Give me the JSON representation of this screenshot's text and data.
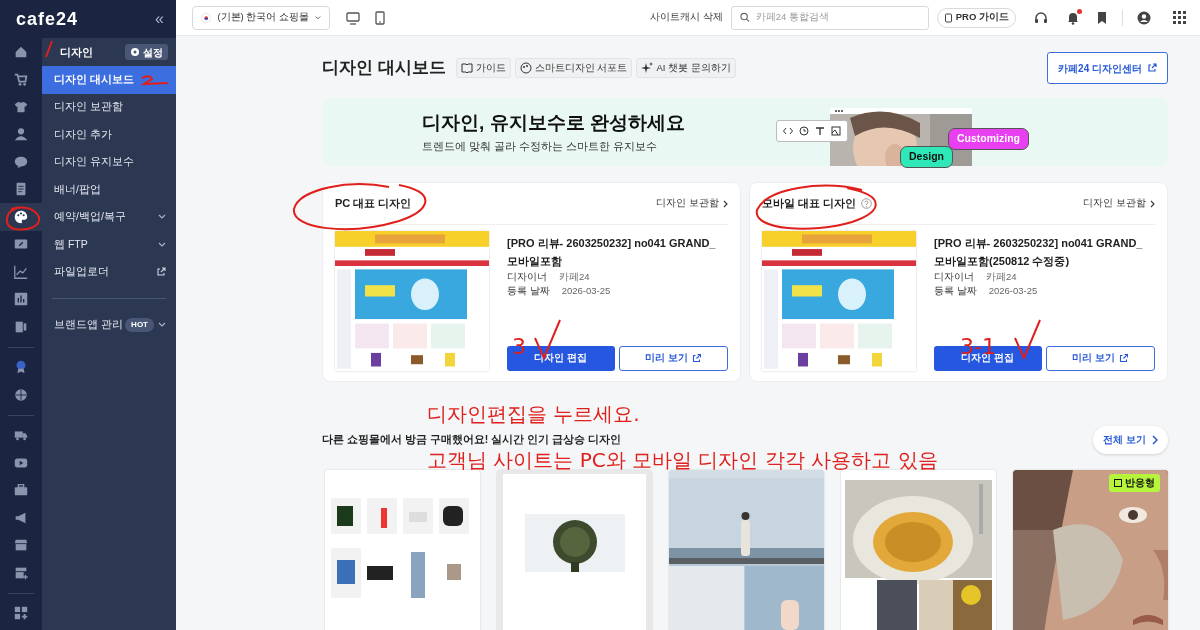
{
  "sidebar": {
    "logo": "cafe24",
    "collapse": "«",
    "rail": [
      {
        "selected": false
      },
      {
        "selected": false
      },
      {
        "selected": false
      },
      {
        "selected": false
      },
      {
        "selected": false
      },
      {
        "selected": false
      },
      {
        "selected": true
      },
      {
        "selected": false
      },
      {
        "selected": false
      },
      {
        "selected": false
      },
      {
        "selected": false
      },
      {
        "selected": false
      },
      {
        "selected": false
      },
      {
        "selected": false
      },
      {
        "selected": false
      },
      {
        "selected": false
      },
      {
        "selected": false
      },
      {
        "selected": false
      },
      {
        "selected": false
      },
      {
        "selected": false
      }
    ],
    "section_title": "디자인",
    "settings_button": "설정",
    "menu": [
      {
        "label": "디자인 대시보드",
        "selected": true,
        "kind": "plain"
      },
      {
        "label": "디자인 보관함",
        "selected": false,
        "kind": "plain"
      },
      {
        "label": "디자인 추가",
        "selected": false,
        "kind": "plain"
      },
      {
        "label": "디자인 유지보수",
        "selected": false,
        "kind": "plain"
      },
      {
        "label": "배너/팝업",
        "selected": false,
        "kind": "plain"
      },
      {
        "label": "예약/백업/복구",
        "selected": false,
        "kind": "submenu"
      },
      {
        "label": "웹 FTP",
        "selected": false,
        "kind": "submenu"
      },
      {
        "label": "파일업로더",
        "selected": false,
        "kind": "external"
      },
      {
        "label": "브랜드앱 관리",
        "selected": false,
        "kind": "submenu",
        "badge": "HOT"
      }
    ]
  },
  "topbar": {
    "store_select": "(기본) 한국어 쇼핑몰",
    "cache_button": "사이트캐시 삭제",
    "search": {
      "placeholder": "카페24 통합검색"
    },
    "pro_guide": "PRO 가이드",
    "notification_dot": true
  },
  "header": {
    "title": "디자인 대시보드",
    "chips": [
      "가이드",
      "스마트디자인 서포트",
      "AI 챗봇 문의하기"
    ],
    "design_center": "카페24 디자인센터"
  },
  "banner": {
    "title": "디자인, 유지보수로 완성하세요",
    "subtitle": "트렌드에 맞춰 골라 수정하는 스마트한 유지보수",
    "tags": [
      {
        "label": "Customizing",
        "color": "#e83ff0"
      },
      {
        "label": "Design",
        "color": "#2ee8b8"
      }
    ]
  },
  "cards": [
    {
      "title": "PC 대표 디자인",
      "help": false,
      "link": "디자인 보관함",
      "name": "[PRO 리뷰- 2603250232] no041 GRAND_ 모바일포함",
      "fields": [
        {
          "label": "디자이너",
          "value": "카페24"
        },
        {
          "label": "등록 날짜",
          "value": "2026-03-25"
        }
      ],
      "edit": "디자인 편집",
      "preview": "미리 보기"
    },
    {
      "title": "모바일 대표 디자인",
      "help": true,
      "link": "디자인 보관함",
      "name": "[PRO 리뷰- 2603250232] no041 GRAND_ 모바일포함(250812 수정중)",
      "fields": [
        {
          "label": "디자이너",
          "value": "카페24"
        },
        {
          "label": "등록 날짜",
          "value": "2026-03-25"
        }
      ],
      "edit": "디자인 편집",
      "preview": "미리 보기"
    }
  ],
  "trending": {
    "title": "다른 쇼핑몰에서 방금 구매했어요! 실시간 인기 급상승 디자인",
    "view_all": "전체 보기",
    "items": [
      {
        "kind": "picture"
      },
      {
        "kind": "picture"
      },
      {
        "kind": "picture"
      },
      {
        "kind": "picture"
      },
      {
        "kind": "picture",
        "badge": "반응형"
      }
    ]
  },
  "annotations": {
    "marks": [
      "3",
      "3-1"
    ],
    "notes": [
      "디자인편집을 누르세요.",
      "고객님 사이트는 PC와 모바일 디자인 각각 사용하고 있음"
    ]
  }
}
